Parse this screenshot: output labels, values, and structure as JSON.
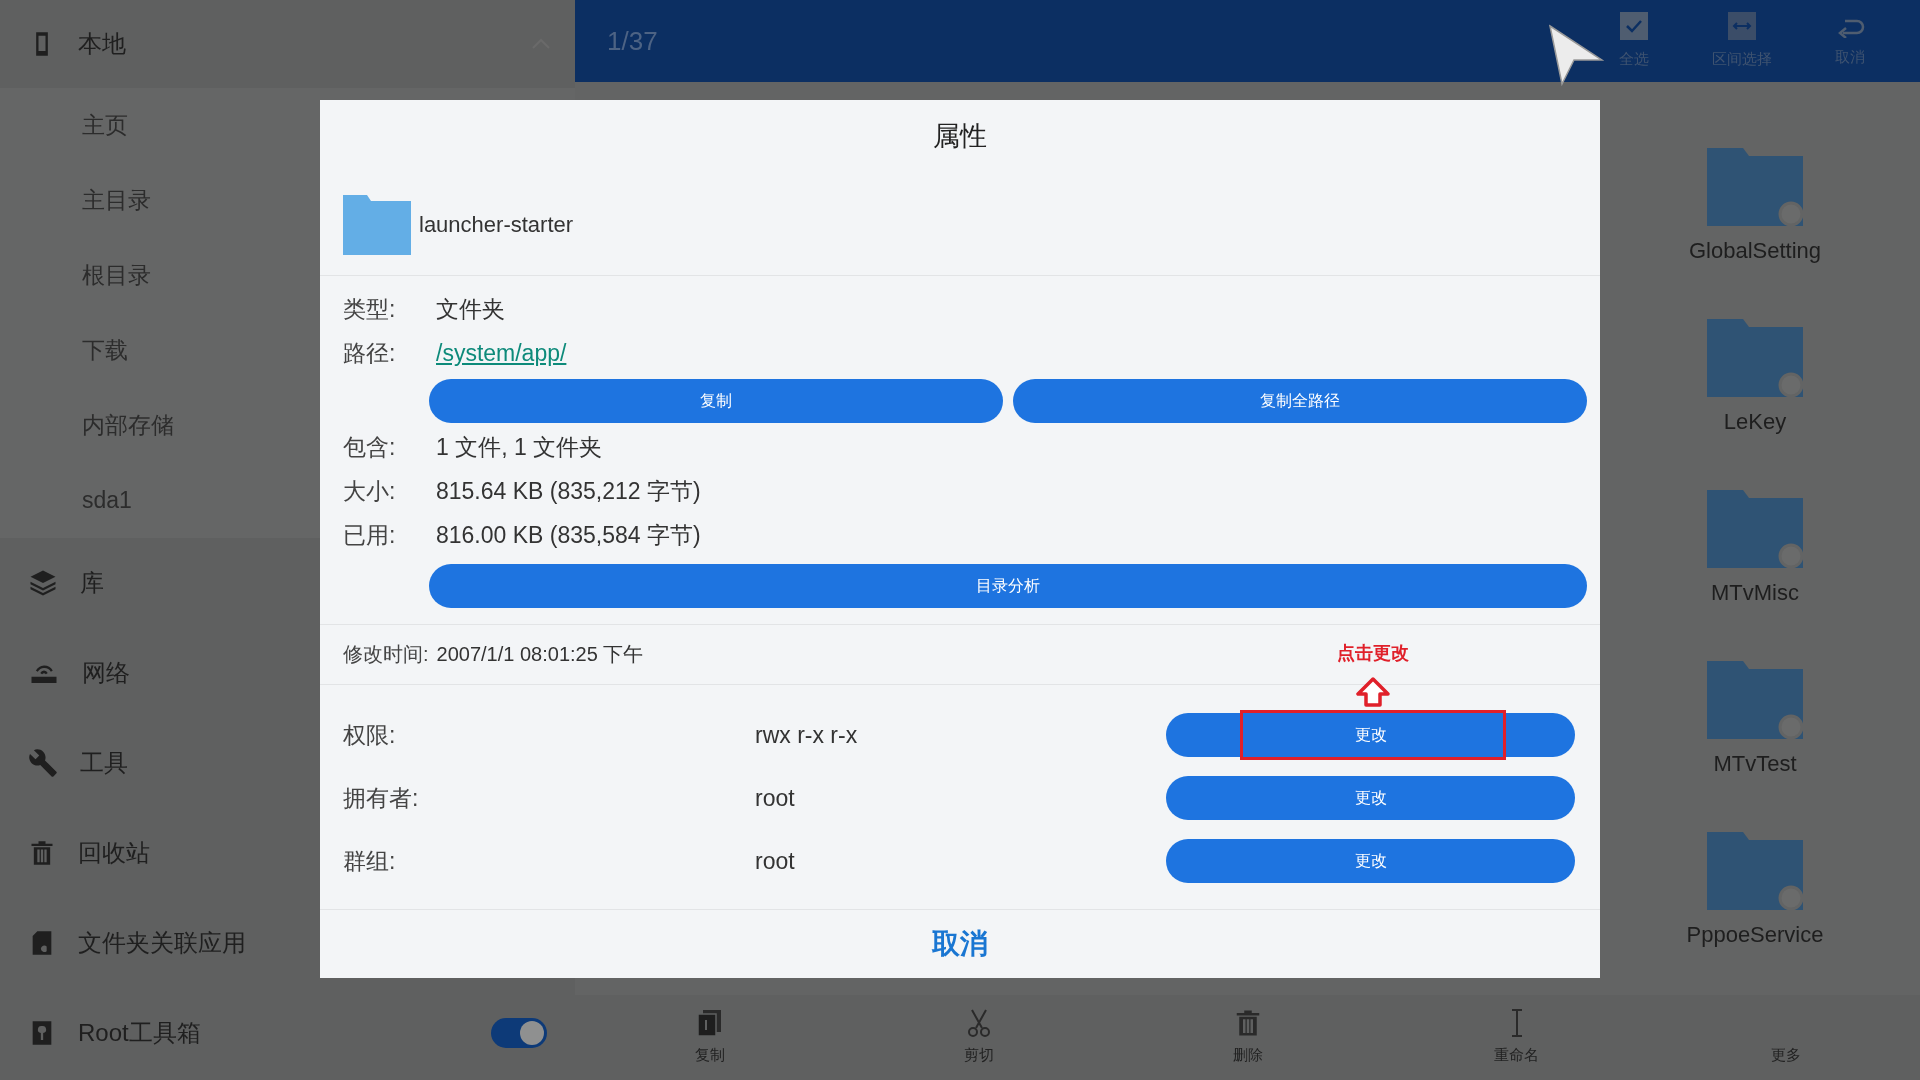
{
  "sidebar": {
    "header": {
      "label": "本地",
      "expanded": true,
      "children": [
        {
          "label": "主页"
        },
        {
          "label": "主目录"
        },
        {
          "label": "根目录"
        },
        {
          "label": "下载"
        },
        {
          "label": "内部存储"
        },
        {
          "label": "sda1"
        }
      ]
    },
    "items": [
      {
        "label": "库",
        "kind": "link"
      },
      {
        "label": "网络",
        "kind": "link"
      },
      {
        "label": "工具",
        "kind": "link"
      },
      {
        "label": "回收站",
        "kind": "link"
      },
      {
        "label": "文件夹关联应用",
        "kind": "link"
      },
      {
        "label": "Root工具箱",
        "kind": "toggle",
        "on": true
      }
    ]
  },
  "top_bar": {
    "counter": "1/37",
    "actions": [
      {
        "label": "全选"
      },
      {
        "label": "区间选择"
      },
      {
        "label": "取消"
      }
    ]
  },
  "files": [
    {
      "name": "GlobalSetting"
    },
    {
      "name": "LeKey"
    },
    {
      "name": "MTvMisc"
    },
    {
      "name": "MTvTest"
    },
    {
      "name": "PppoeService"
    }
  ],
  "dialog": {
    "title": "属性",
    "file_name": "launcher-starter",
    "info": [
      {
        "label": "类型:",
        "value": "文件夹",
        "kind": "text"
      },
      {
        "label": "路径:",
        "value": "/system/app/",
        "kind": "link"
      }
    ],
    "path_buttons": [
      "复制",
      "复制全路径"
    ],
    "sizes": [
      {
        "label": "包含:",
        "value": "1 文件, 1 文件夹"
      },
      {
        "label": "大小:",
        "value": "815.64 KB (835,212 字节)"
      },
      {
        "label": "已用:",
        "value": "816.00 KB (835,584 字节)"
      }
    ],
    "analyze_button": "目录分析",
    "modified": {
      "label": "修改时间:",
      "value": "2007/1/1 08:01:25 下午"
    },
    "permissions": [
      {
        "label": "权限:",
        "value": "rwx r-x r-x",
        "button": "更改",
        "highlighted": true
      },
      {
        "label": "拥有者:",
        "value": "root",
        "button": "更改",
        "highlighted": false
      },
      {
        "label": "群组:",
        "value": "root",
        "button": "更改",
        "highlighted": false
      }
    ],
    "cancel": "取消"
  },
  "annotation": "点击更改",
  "bottom_bar": [
    {
      "label": "复制"
    },
    {
      "label": "剪切"
    },
    {
      "label": "删除"
    },
    {
      "label": "重命名"
    },
    {
      "label": "更多"
    }
  ]
}
